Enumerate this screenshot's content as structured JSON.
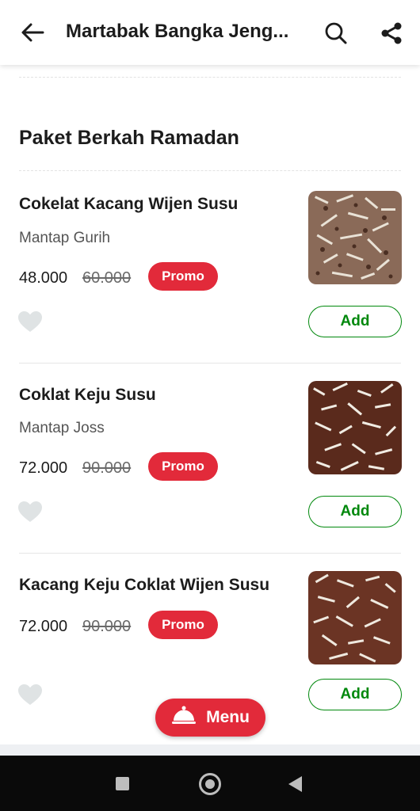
{
  "header": {
    "title": "Martabak Bangka Jeng...",
    "back_icon": "arrow-left-icon",
    "search_icon": "search-icon",
    "share_icon": "share-icon"
  },
  "section": {
    "title": "Paket Berkah Ramadan"
  },
  "items": [
    {
      "name": "Cokelat Kacang Wijen Susu",
      "description": "Mantap Gurih",
      "price": "48.000",
      "old_price": "60.000",
      "promo_label": "Promo",
      "add_label": "Add"
    },
    {
      "name": "Coklat Keju Susu",
      "description": "Mantap Joss",
      "price": "72.000",
      "old_price": "90.000",
      "promo_label": "Promo",
      "add_label": "Add"
    },
    {
      "name": "Kacang Keju Coklat Wijen Susu",
      "description": "",
      "price": "72.000",
      "old_price": "90.000",
      "promo_label": "Promo",
      "add_label": "Add"
    }
  ],
  "menu_button": {
    "label": "Menu",
    "icon": "food-cloche-icon"
  },
  "colors": {
    "accent_red": "#e22a3a",
    "add_green": "#00880c"
  }
}
